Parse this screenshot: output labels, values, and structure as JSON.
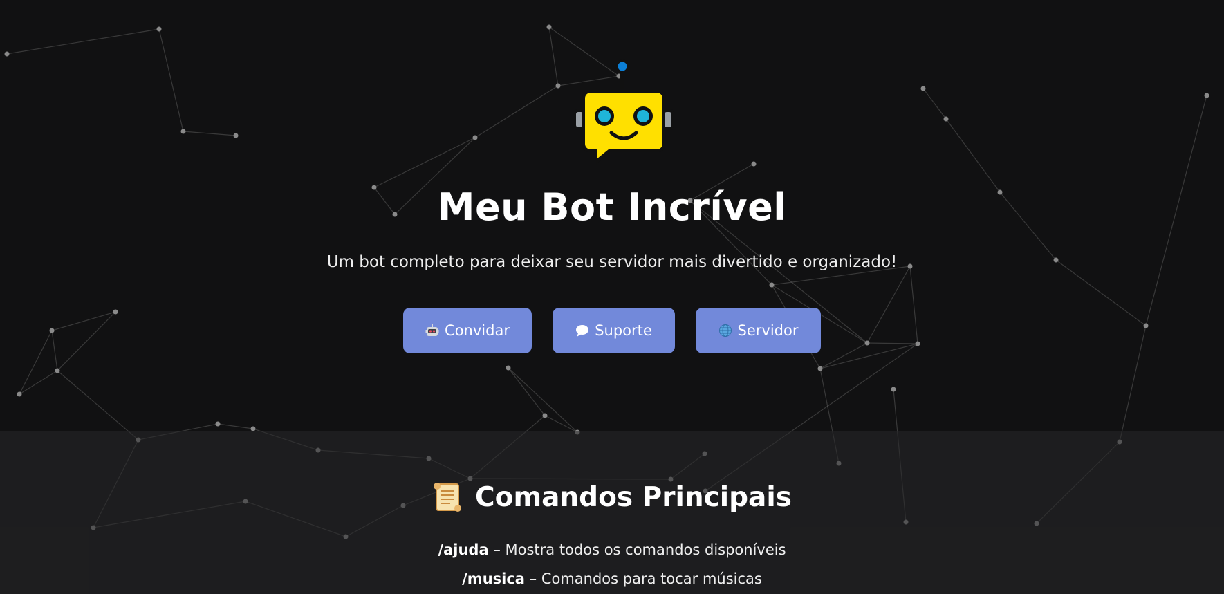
{
  "hero": {
    "title": "Meu Bot Incrível",
    "subtitle": "Um bot completo para deixar seu servidor mais divertido e organizado!",
    "logo_icon": "robot-chat-icon"
  },
  "buttons": [
    {
      "label": "Convidar",
      "icon": "robot-face-icon"
    },
    {
      "label": "Suporte",
      "icon": "speech-bubble-icon"
    },
    {
      "label": "Servidor",
      "icon": "globe-icon"
    }
  ],
  "commands": {
    "heading": "Comandos Principais",
    "heading_icon": "scroll-icon",
    "items": [
      {
        "name": "/ajuda",
        "separator": " – ",
        "description": "Mostra todos os comandos disponíveis"
      },
      {
        "name": "/musica",
        "separator": " – ",
        "description": "Comandos para tocar músicas"
      }
    ]
  },
  "colors": {
    "background": "#111112",
    "button": "#7289da",
    "section_background": "#1e1e20",
    "particle": "#8a8a8a",
    "logo_yellow": "#ffe000",
    "logo_eye": "#1fb5d9",
    "antenna": "#0c7fd6"
  }
}
